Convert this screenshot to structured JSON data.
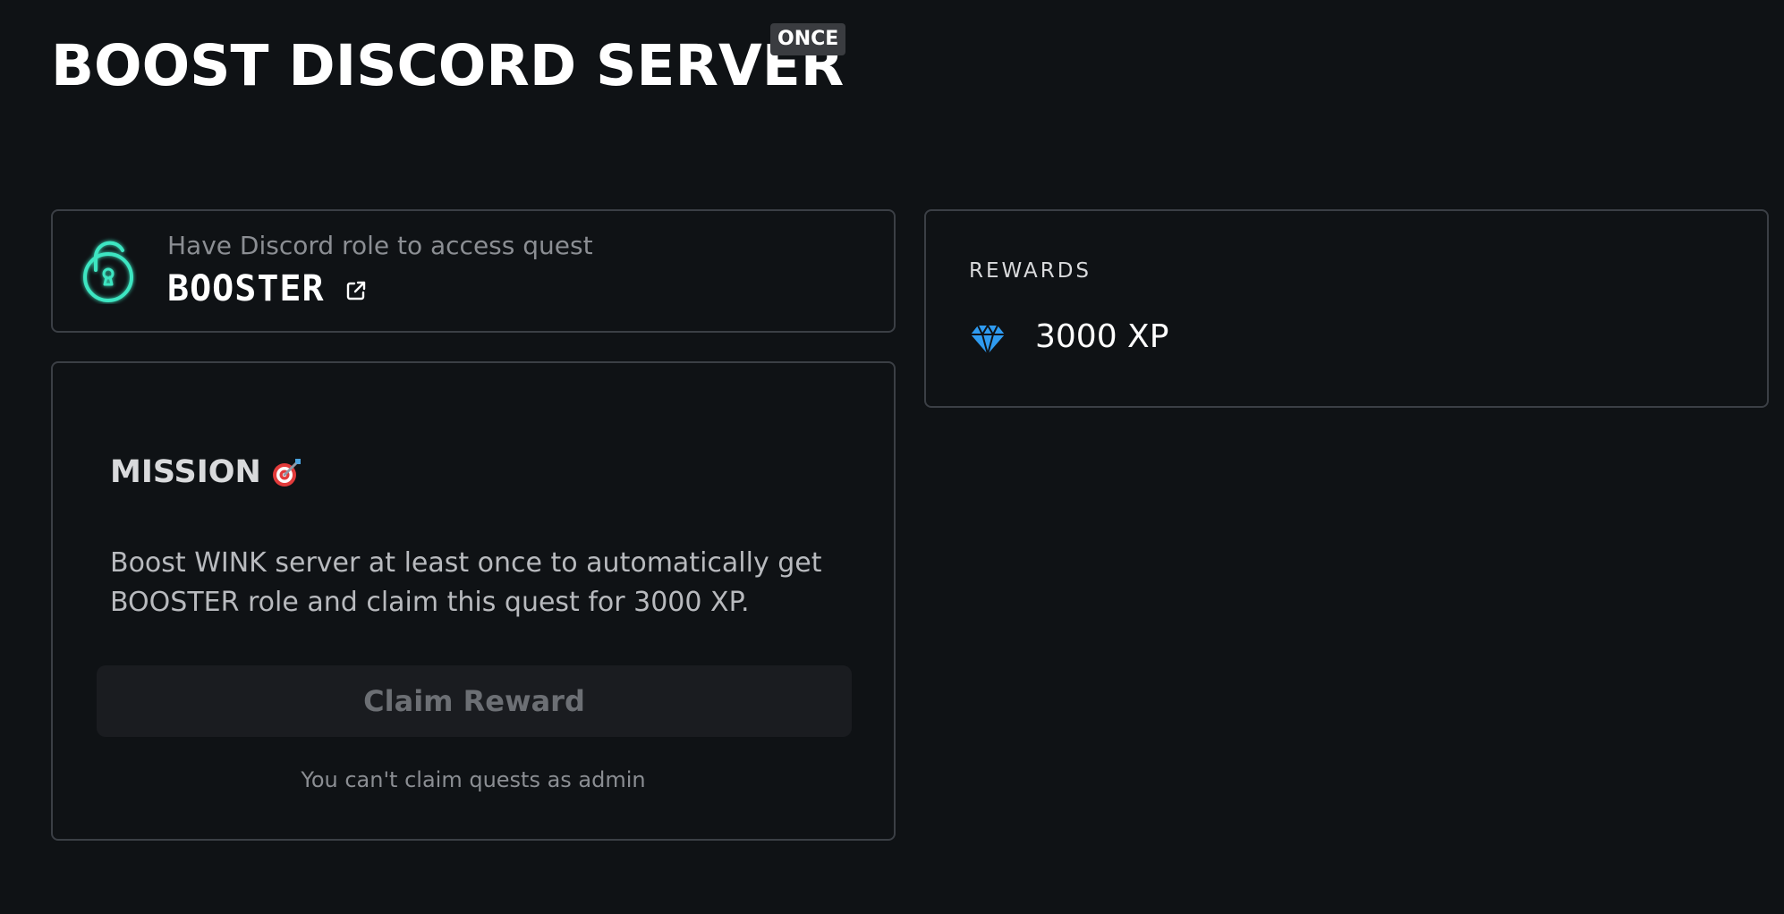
{
  "header": {
    "title": "BOOST DISCORD SERVER",
    "frequency_badge": "ONCE"
  },
  "requirement": {
    "caption": "Have Discord role to access quest",
    "role_name": "BOOSTER",
    "icons": {
      "lock": "unlocked-padlock-icon",
      "link": "external-link-icon"
    },
    "accent_color": "#3ee6c2"
  },
  "mission": {
    "heading": "MISSION",
    "heading_icon": "dart-target-icon",
    "description": "Boost WINK server at least once to automatically get BOOSTER role and claim this quest for 3000 XP.",
    "claim_label": "Claim Reward",
    "claim_disabled": true,
    "note": "You can't claim quests as admin"
  },
  "rewards": {
    "label": "REWARDS",
    "value": "3000 XP",
    "icon": "diamond-icon",
    "icon_color": "#2f9bf0"
  }
}
